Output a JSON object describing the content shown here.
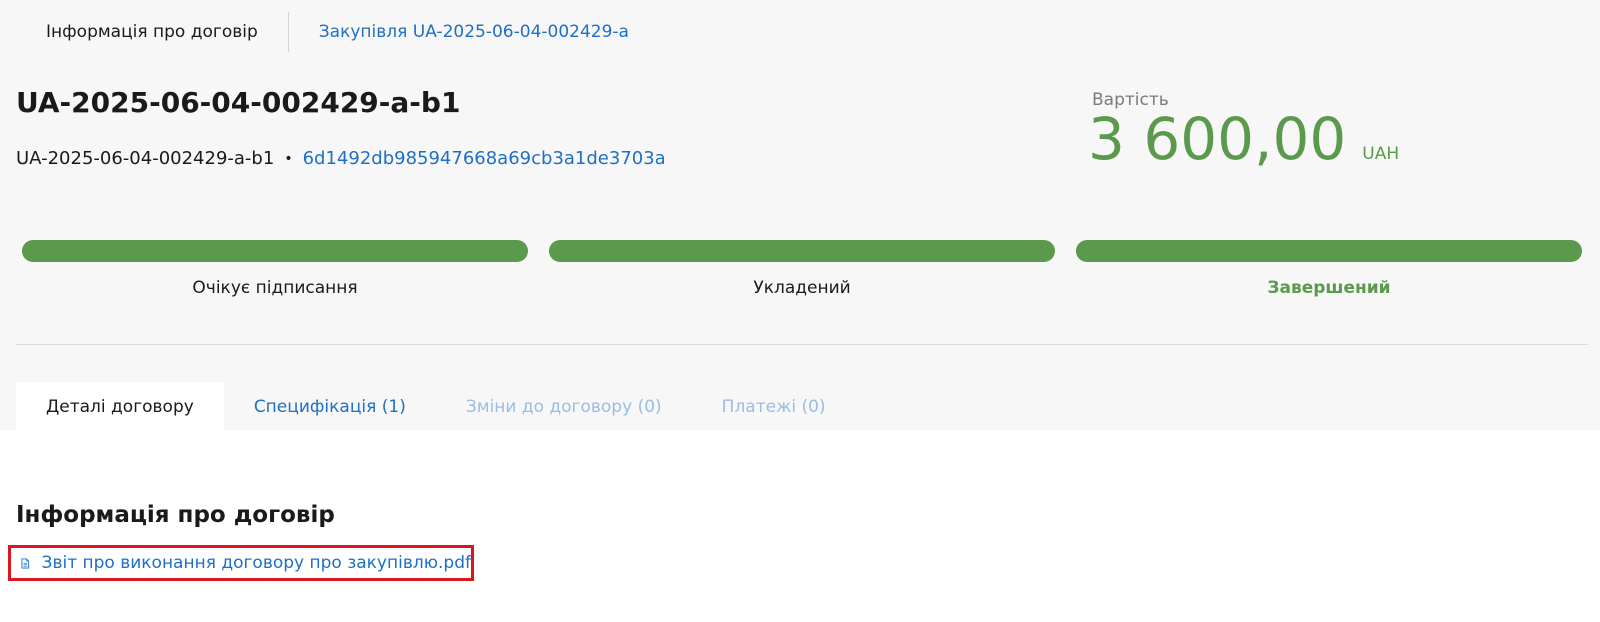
{
  "top_tabs": {
    "info": "Інформація про договір",
    "procurement": "Закупівля UA-2025-06-04-002429-a"
  },
  "contract": {
    "title": "UA-2025-06-04-002429-a-b1",
    "id": "UA-2025-06-04-002429-a-b1",
    "separator": "•",
    "hash": "6d1492db985947668a69cb3a1de3703a"
  },
  "price": {
    "label": "Вартість",
    "value": "3 600,00",
    "currency": "UAH"
  },
  "status_steps": [
    {
      "label": "Очікує підписання",
      "progress": 1.0
    },
    {
      "label": "Укладений",
      "progress": 1.0
    },
    {
      "label": "Завершений",
      "progress": 1.0
    }
  ],
  "content_tabs": [
    {
      "label": "Деталі договору",
      "state": "active"
    },
    {
      "label": "Специфікація (1)",
      "state": "link"
    },
    {
      "label": "Зміни до договору (0)",
      "state": "disabled"
    },
    {
      "label": "Платежі (0)",
      "state": "disabled"
    }
  ],
  "info_section": {
    "title": "Інформація про договір",
    "document": "Звіт про виконання договору про закупівлю.pdf",
    "document_icon": "document-icon"
  },
  "colors": {
    "accent_green": "#5b9a4c",
    "link_blue": "#1f6fc5",
    "highlight_red": "#e0141e"
  }
}
